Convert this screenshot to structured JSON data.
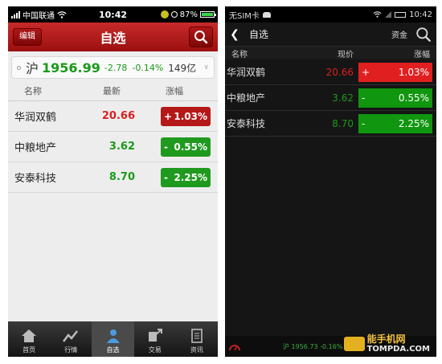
{
  "ios": {
    "status": {
      "carrier": "中国联通",
      "time": "10:42",
      "battery": "87%"
    },
    "nav": {
      "edit_label": "编辑",
      "title": "自选"
    },
    "index": {
      "market": "沪",
      "value": "1956.99",
      "change": "-2.78",
      "change_pct": "-0.14%",
      "turnover": "149亿"
    },
    "columns": [
      "名称",
      "最新",
      "涨幅"
    ],
    "rows": [
      {
        "name": "华润双鹤",
        "price": "20.66",
        "sign": "+",
        "pct": "1.03%",
        "dir": "up"
      },
      {
        "name": "中粮地产",
        "price": "3.62",
        "sign": "-",
        "pct": "0.55%",
        "dir": "down"
      },
      {
        "name": "安泰科技",
        "price": "8.70",
        "sign": "-",
        "pct": "2.25%",
        "dir": "down"
      }
    ],
    "tabs": [
      {
        "label": "首页",
        "icon": "home-icon"
      },
      {
        "label": "行情",
        "icon": "trend-icon"
      },
      {
        "label": "自选",
        "icon": "person-icon",
        "selected": true
      },
      {
        "label": "交易",
        "icon": "trade-icon"
      },
      {
        "label": "资讯",
        "icon": "news-icon"
      }
    ]
  },
  "android": {
    "status": {
      "sim": "无SIM卡",
      "time": "10:42"
    },
    "nav": {
      "title": "自选",
      "funds_label": "资金"
    },
    "columns": [
      "名称",
      "现价",
      "涨幅"
    ],
    "rows": [
      {
        "name": "华润双鹤",
        "price": "20.66",
        "sign": "+",
        "pct": "1.03%",
        "dir": "up"
      },
      {
        "name": "中粮地产",
        "price": "3.62",
        "sign": "-",
        "pct": "0.55%",
        "dir": "down"
      },
      {
        "name": "安泰科技",
        "price": "8.70",
        "sign": "-",
        "pct": "2.25%",
        "dir": "down"
      }
    ],
    "footer": {
      "index_text": "沪 1956.73 -0.16%"
    }
  },
  "watermark": {
    "line1": "能手机网",
    "line2": "TOMPDA.COM"
  },
  "colors": {
    "up": "#d82020",
    "down": "#1a9a1a",
    "ios_up_bg": "#b51818",
    "ios_down_bg": "#1f9a1f",
    "and_up_bg": "#e02020",
    "and_down_bg": "#10960f"
  }
}
